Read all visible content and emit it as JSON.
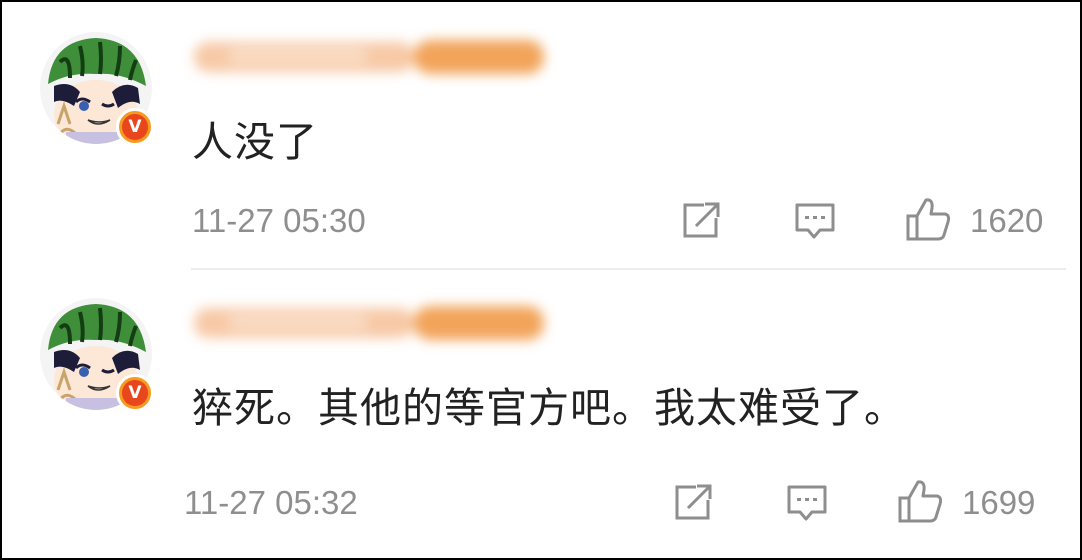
{
  "comments": [
    {
      "text": "人没了",
      "time": "11-27 05:30",
      "likes": "1620",
      "verified_badge": "V",
      "avatar": "watermelon-helmet-anime-avatar"
    },
    {
      "text": "猝死。其他的等官方吧。我太难受了。",
      "time": "11-27 05:32",
      "likes": "1699",
      "verified_badge": "V",
      "avatar": "watermelon-helmet-anime-avatar"
    }
  ],
  "colors": {
    "text": "#222222",
    "meta": "#8e8e8e",
    "badge_outer": "#f79a1f",
    "badge_inner": "#e8461c",
    "username_blur": "#f6b27a"
  },
  "icons": [
    "share-icon",
    "comment-icon",
    "like-icon"
  ]
}
